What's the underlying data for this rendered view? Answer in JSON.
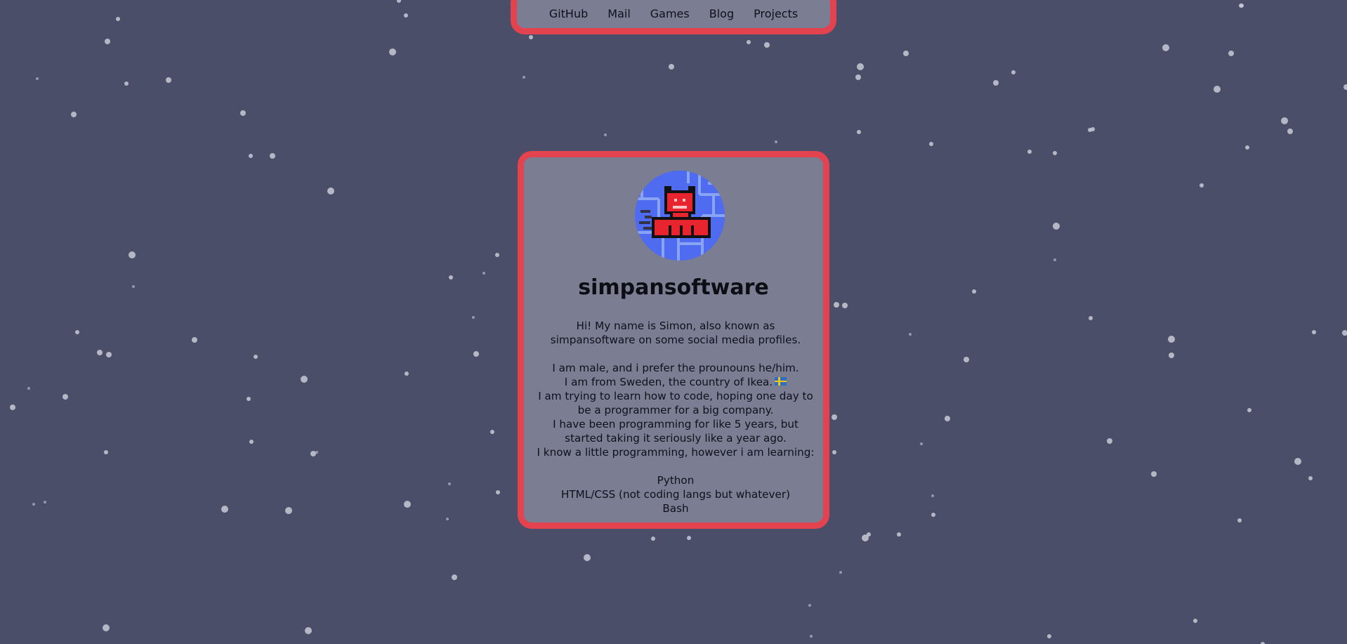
{
  "nav": {
    "links": [
      {
        "label": "GitHub"
      },
      {
        "label": "Mail"
      },
      {
        "label": "Games"
      },
      {
        "label": "Blog"
      },
      {
        "label": "Projects"
      }
    ]
  },
  "profile": {
    "avatar_icon": "red-pixel-cat-avatar",
    "username": "simpansoftware",
    "intro": [
      "Hi! My name is Simon, also known as",
      "simpansoftware on some social media profiles."
    ],
    "details": [
      "I am male, and i prefer the prounouns he/him.",
      "I am from Sweden, the country of Ikea.",
      "I am trying to learn how to code, hoping one day to",
      "be a programmer for a big company.",
      "I have been programming for like 5 years, but",
      "started taking it seriously like a year ago.",
      "I know a little programming, however i am learning:"
    ],
    "flag_icon": "sweden-flag-icon",
    "languages": [
      "Python",
      "HTML/CSS (not coding langs but whatever)",
      "Bash"
    ]
  },
  "colors": {
    "background": "#4a4e69",
    "panel": "#7b7d93",
    "panel_border": "#e2434f",
    "star": "#c9cad6",
    "avatar_bg": "#4f6bf0"
  }
}
